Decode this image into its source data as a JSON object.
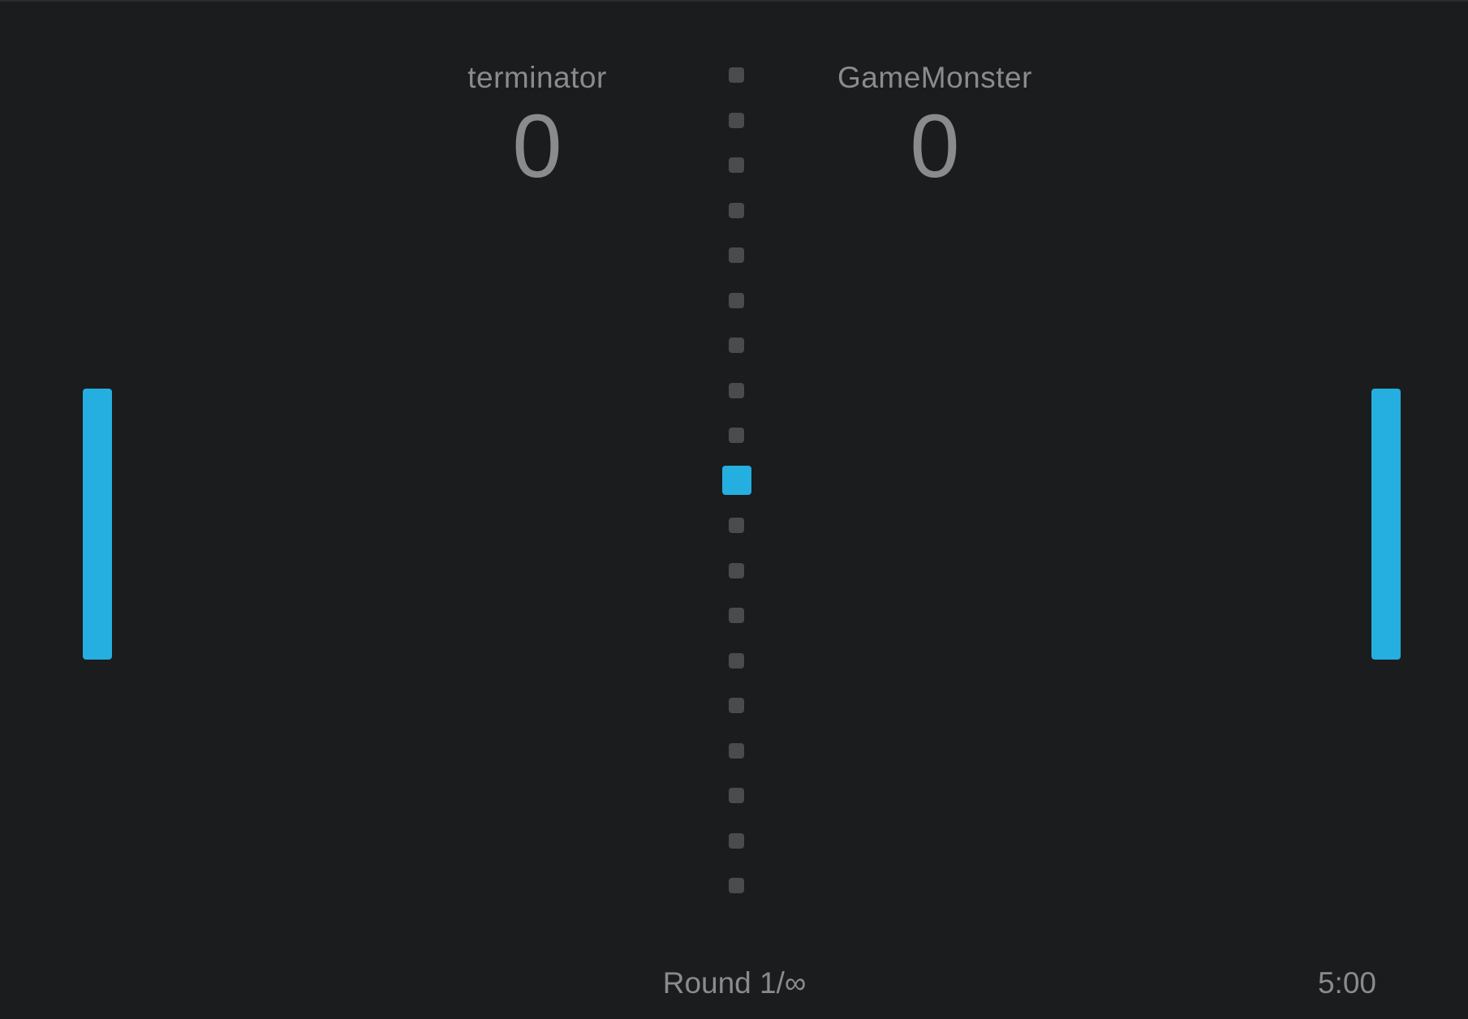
{
  "players": {
    "left": {
      "name": "terminator",
      "score": "0"
    },
    "right": {
      "name": "GameMonster",
      "score": "0"
    }
  },
  "round": "Round 1/∞",
  "timer": "5:00",
  "colors": {
    "background": "#1b1c1e",
    "paddle": "#25aee0",
    "ball": "#25aee0",
    "net": "#4a4b4d",
    "text": "#8a8b8c"
  }
}
